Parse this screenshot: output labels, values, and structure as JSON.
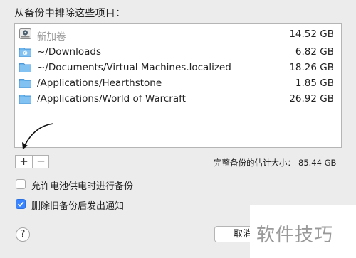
{
  "dialog": {
    "heading": "从备份中排除这些项目：",
    "items": [
      {
        "name": "新加卷",
        "size": "14.52 GB",
        "icon": "drive-icon",
        "disabled": true
      },
      {
        "name": "~/Downloads",
        "size": "6.82 GB",
        "icon": "folder-icon"
      },
      {
        "name": "~/Documents/Virtual Machines.localized",
        "size": "18.26 GB",
        "icon": "folder-icon"
      },
      {
        "name": "/Applications/Hearthstone",
        "size": "1.85 GB",
        "icon": "folder-icon"
      },
      {
        "name": "/Applications/World of Warcraft",
        "size": "26.92 GB",
        "icon": "folder-icon"
      }
    ],
    "add_label": "+",
    "remove_label": "−",
    "total_label": "完整备份的估计大小：",
    "total_value": "85.44 GB",
    "options": [
      {
        "label": "允许电池供电时进行备份",
        "checked": false
      },
      {
        "label": "删除旧备份后发出通知",
        "checked": true
      }
    ],
    "help_label": "?",
    "cancel_label": "取消"
  },
  "watermark": "软件技巧",
  "colors": {
    "folder": "#6bb5ee",
    "accent": "#3a84ff",
    "background": "#ececec"
  }
}
